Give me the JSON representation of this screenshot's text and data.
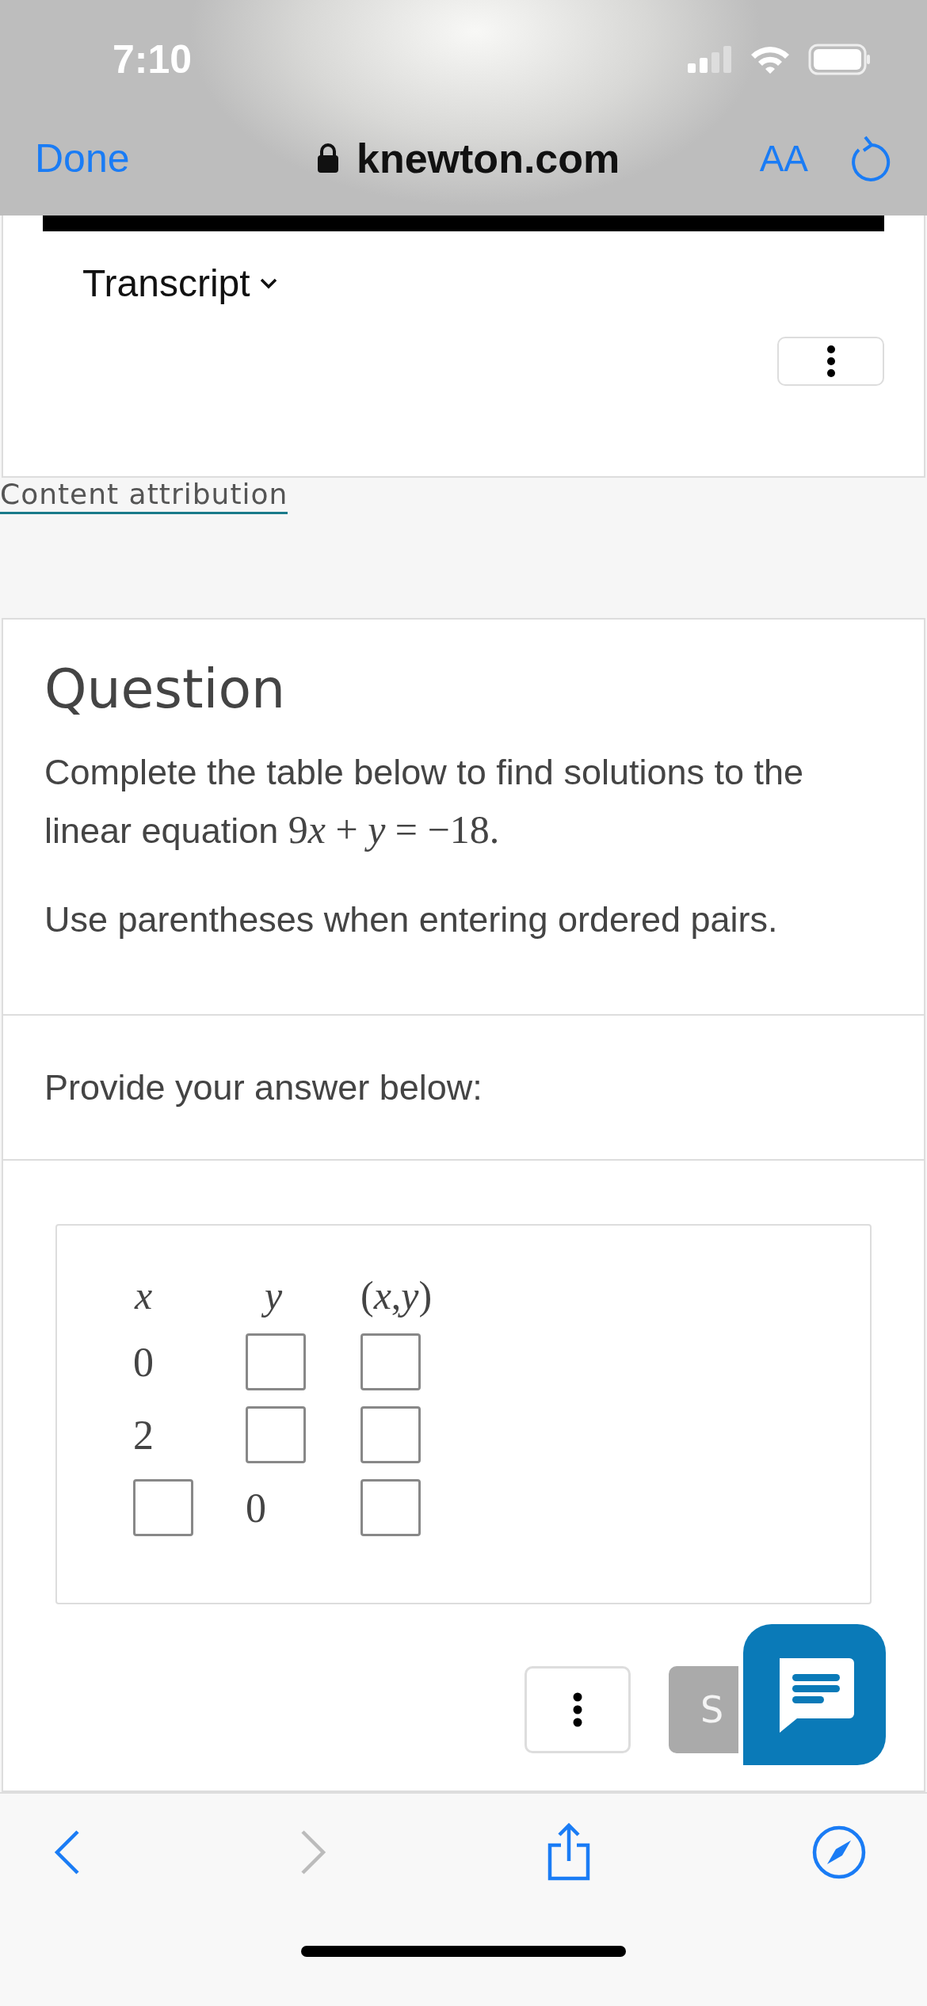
{
  "status_bar": {
    "time": "7:10"
  },
  "browser_bar": {
    "done": "Done",
    "url": "knewton.com",
    "text_size": "AA"
  },
  "transcript": {
    "label": "Transcript"
  },
  "attribution": {
    "link": "Content attribution"
  },
  "question": {
    "heading": "Question",
    "prompt": {
      "text": "Complete the table below to find solutions to the linear equation ",
      "equation": [
        {
          "kind": "num",
          "text": "9"
        },
        {
          "kind": "var",
          "text": "x"
        },
        {
          "kind": "op",
          "text": " + "
        },
        {
          "kind": "var",
          "text": "y"
        },
        {
          "kind": "op",
          "text": " = "
        },
        {
          "kind": "num",
          "text": "−18."
        }
      ]
    },
    "note": "Use parentheses when entering ordered pairs.",
    "answer_label": "Provide your answer below:",
    "table": {
      "columns": [
        "x",
        "y",
        "(*x*,*y*)"
      ],
      "rows": [
        [
          {
            "kind": "text",
            "text": "0"
          },
          {
            "kind": "input"
          },
          {
            "kind": "input"
          }
        ],
        [
          {
            "kind": "text",
            "text": "2"
          },
          {
            "kind": "input"
          },
          {
            "kind": "input"
          }
        ],
        [
          {
            "kind": "input"
          },
          {
            "kind": "text",
            "text": "0"
          },
          {
            "kind": "input"
          }
        ]
      ]
    },
    "submit": {
      "label": "S",
      "disabled": true
    }
  },
  "toolbar": [
    {
      "kind": "back",
      "disabled": false
    },
    {
      "kind": "forward",
      "disabled": true
    },
    {
      "kind": "share",
      "disabled": false
    },
    {
      "kind": "compass",
      "disabled": false
    }
  ]
}
